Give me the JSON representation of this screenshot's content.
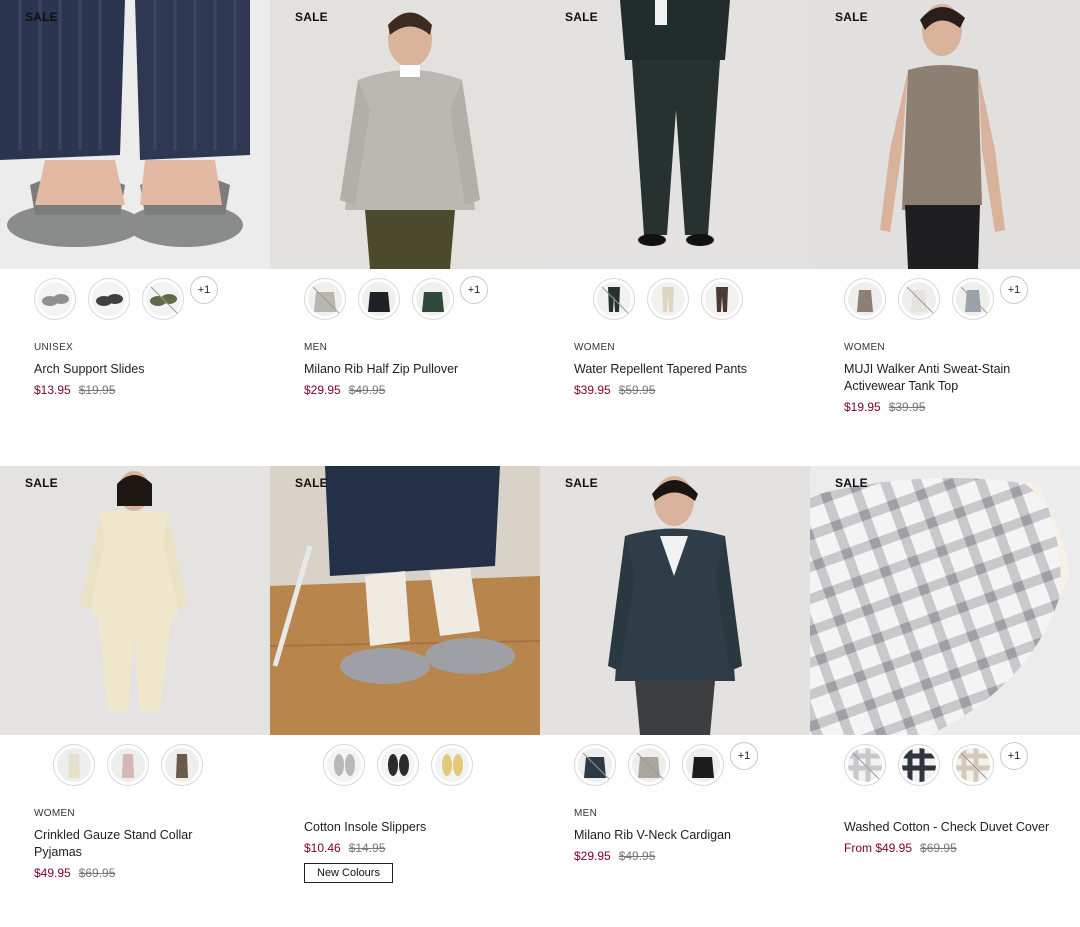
{
  "products": [
    {
      "sale_label": "SALE",
      "image_icon": "slides-photo",
      "swatches": [
        {
          "color": "#8e8f8e",
          "icon": "slide-grey",
          "unavailable": false
        },
        {
          "color": "#3f4140",
          "icon": "slide-black",
          "unavailable": false
        },
        {
          "color": "#5f6b46",
          "icon": "slide-khaki",
          "unavailable": true
        }
      ],
      "more_label": "+1",
      "gender": "UNISEX",
      "name": "Arch Support Slides",
      "price_now": "$13.95",
      "price_was": "$19.95",
      "badge": ""
    },
    {
      "sale_label": "SALE",
      "image_icon": "pullover-photo",
      "swatches": [
        {
          "color": "#b8b6ae",
          "icon": "pullover-light",
          "unavailable": true
        },
        {
          "color": "#1d2126",
          "icon": "pullover-navy",
          "unavailable": false
        },
        {
          "color": "#2f4a3a",
          "icon": "pullover-green",
          "unavailable": false
        }
      ],
      "more_label": "+1",
      "gender": "MEN",
      "name": "Milano Rib Half Zip Pullover",
      "price_now": "$29.95",
      "price_was": "$49.95",
      "badge": ""
    },
    {
      "sale_label": "SALE",
      "image_icon": "pants-photo",
      "swatches": [
        {
          "color": "#263130",
          "icon": "pants-dark",
          "unavailable": true
        },
        {
          "color": "#ded6c3",
          "icon": "pants-beige",
          "unavailable": false
        },
        {
          "color": "#4a3a32",
          "icon": "pants-brown",
          "unavailable": false
        }
      ],
      "more_label": "",
      "gender": "WOMEN",
      "name": "Water Repellent Tapered Pants",
      "price_now": "$39.95",
      "price_was": "$59.95",
      "badge": ""
    },
    {
      "sale_label": "SALE",
      "image_icon": "tank-top-photo",
      "swatches": [
        {
          "color": "#8e7f73",
          "icon": "tank-taupe",
          "unavailable": false
        },
        {
          "color": "#e5e3de",
          "icon": "tank-white",
          "unavailable": true
        },
        {
          "color": "#9aa3ad",
          "icon": "tank-grey",
          "unavailable": true
        }
      ],
      "more_label": "+1",
      "gender": "WOMEN",
      "name": "MUJI Walker Anti Sweat-Stain Activewear Tank Top",
      "price_now": "$19.95",
      "price_was": "$39.95",
      "badge": ""
    },
    {
      "sale_label": "SALE",
      "image_icon": "pyjamas-photo",
      "swatches": [
        {
          "color": "#e6dfcc",
          "icon": "pyjamas-cream",
          "unavailable": false
        },
        {
          "color": "#d8b8b4",
          "icon": "pyjamas-pink",
          "unavailable": false
        },
        {
          "color": "#6a5a4c",
          "icon": "pyjamas-brown",
          "unavailable": false
        }
      ],
      "more_label": "",
      "gender": "WOMEN",
      "name": "Crinkled Gauze Stand Collar Pyjamas",
      "price_now": "$49.95",
      "price_was": "$69.95",
      "badge": ""
    },
    {
      "sale_label": "SALE",
      "image_icon": "slippers-photo",
      "swatches": [
        {
          "color": "#b9b8b8",
          "icon": "slipper-grey",
          "unavailable": false
        },
        {
          "color": "#2b2b2b",
          "icon": "slipper-black",
          "unavailable": false
        },
        {
          "color": "#e3c97a",
          "icon": "slipper-yellow",
          "unavailable": false
        }
      ],
      "more_label": "",
      "gender": "",
      "name": "Cotton Insole Slippers",
      "price_now": "$10.46",
      "price_was": "$14.95",
      "badge": "New Colours"
    },
    {
      "sale_label": "SALE",
      "image_icon": "cardigan-photo",
      "swatches": [
        {
          "color": "#2d3a44",
          "icon": "cardigan-navy",
          "unavailable": true
        },
        {
          "color": "#a9a69e",
          "icon": "cardigan-grey",
          "unavailable": true
        },
        {
          "color": "#1b1c1e",
          "icon": "cardigan-black",
          "unavailable": false
        }
      ],
      "more_label": "+1",
      "gender": "MEN",
      "name": "Milano Rib V-Neck Cardigan",
      "price_now": "$29.95",
      "price_was": "$49.95",
      "badge": ""
    },
    {
      "sale_label": "SALE",
      "image_icon": "duvet-cover-photo",
      "swatches": [
        {
          "color": "#c8c8ca",
          "icon": "check-grey",
          "unavailable": true
        },
        {
          "color": "#30343c",
          "icon": "check-navy",
          "unavailable": false
        },
        {
          "color": "#d6c9b8",
          "icon": "check-beige",
          "unavailable": true
        }
      ],
      "more_label": "+1",
      "gender": "",
      "name": "Washed Cotton - Check Duvet Cover",
      "price_now": "From $49.95",
      "price_was": "$69.95",
      "badge": ""
    }
  ]
}
